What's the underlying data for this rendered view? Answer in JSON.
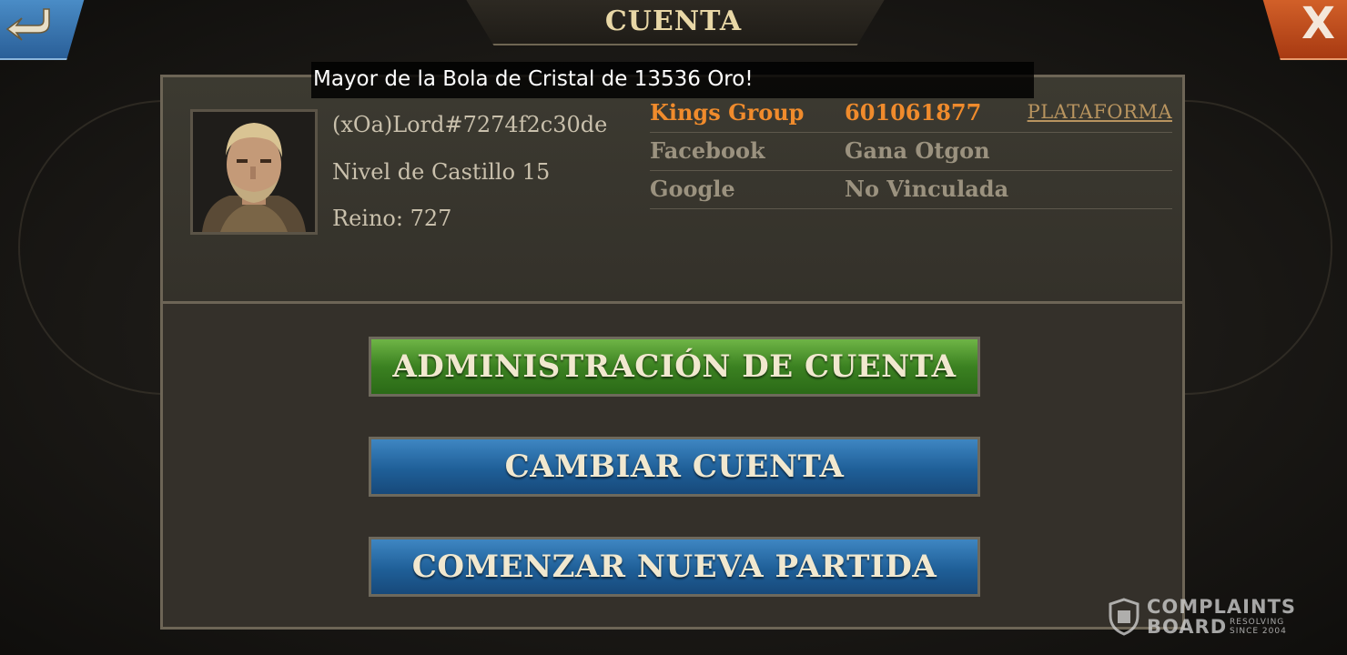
{
  "header": {
    "title": "CUENTA",
    "back_icon": "back-arrow-icon",
    "close_label": "X"
  },
  "banner": {
    "text": "Mayor de la Bola de Cristal de 13536 Oro!"
  },
  "profile": {
    "name": "(xOa)Lord#7274f2c30de",
    "castle_level": "Nivel de Castillo 15",
    "kingdom": "Reino: 727"
  },
  "accounts": [
    {
      "platform": "Kings Group",
      "value": "601061877",
      "highlight": "#f08b2c"
    },
    {
      "platform": "Facebook",
      "value": "Gana Otgon",
      "highlight": "#9b927f"
    },
    {
      "platform": "Google",
      "value": "No Vinculada",
      "highlight": "#9b927f"
    }
  ],
  "platform_link": "PLATAFORMA",
  "buttons": {
    "manage": "ADMINISTRACIÓN DE CUENTA",
    "switch": "CAMBIAR CUENTA",
    "new_game": "COMENZAR NUEVA PARTIDA"
  },
  "watermark": {
    "line1": "COMPLAINTS",
    "line2": "BOARD",
    "tag1": "RESOLVING",
    "tag2": "SINCE 2004"
  }
}
